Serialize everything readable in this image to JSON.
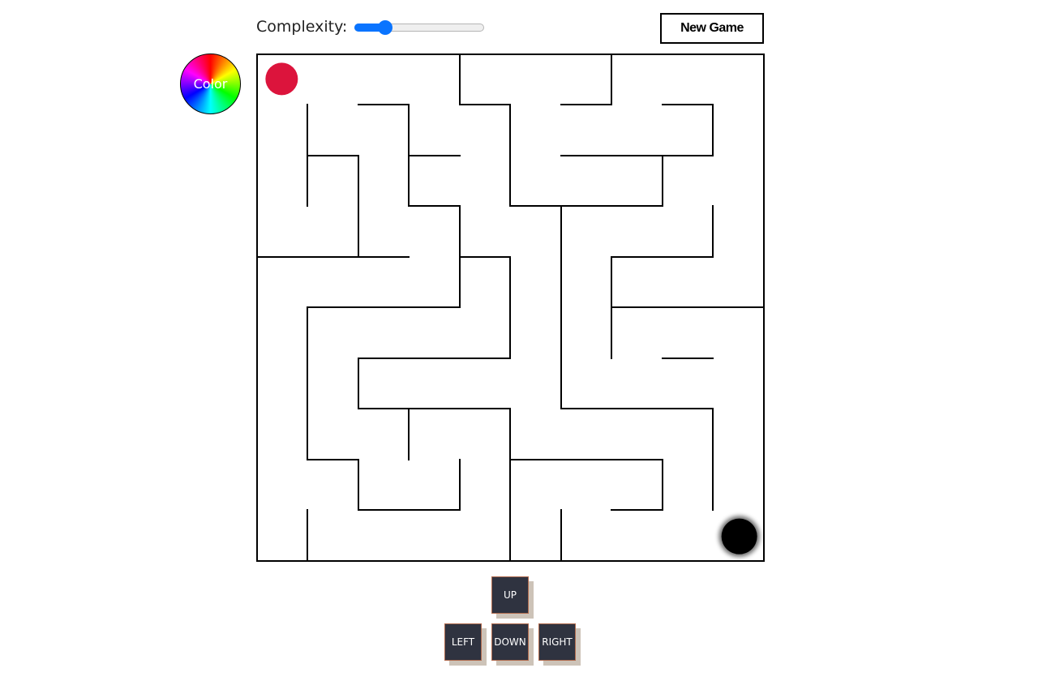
{
  "header": {
    "complexity_label": "Complexity:",
    "complexity_value": 0.24,
    "new_game_label": "New Game"
  },
  "color_picker": {
    "label": "Color"
  },
  "maze": {
    "grid_size": 10,
    "player": {
      "col": 0,
      "row": 0,
      "color": "#dc143c"
    },
    "goal": {
      "col": 9,
      "row": 9,
      "color": "#000000"
    }
  },
  "controls": {
    "up": "UP",
    "left": "LEFT",
    "down": "DOWN",
    "right": "RIGHT"
  }
}
